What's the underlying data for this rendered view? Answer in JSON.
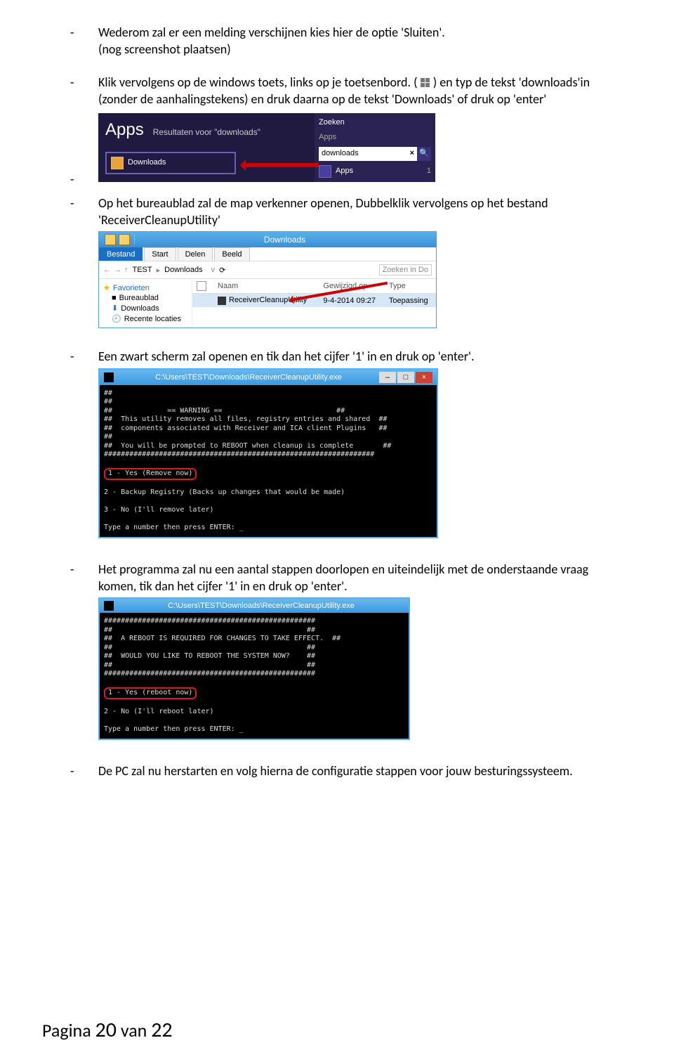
{
  "bullets": {
    "b1": "Wederom zal er een melding verschijnen kies hier de optie 'Sluiten'.",
    "b1_sub": "(nog screenshot plaatsen)",
    "b2": "Klik vervolgens op de windows toets, links op je toetsenbord. (",
    "b2b": ") en typ de tekst 'downloads'in (zonder de aanhalingstekens) en druk daarna op de tekst 'Downloads' of druk op 'enter'",
    "b3": "Op het bureaublad zal de map verkenner openen, Dubbelklik vervolgens op het bestand 'ReceiverCleanupUtility'",
    "b4": "Een zwart scherm zal openen en tik dan het cijfer '1' in en druk op 'enter'.",
    "b5": "Het programma zal nu een aantal stappen doorlopen en uiteindelijk met de onderstaande vraag komen, tik dan het cijfer '1' in en druk op 'enter'.",
    "b6": "De PC zal nu herstarten en volg hierna de configuratie stappen voor jouw besturingssysteem."
  },
  "apps": {
    "title": "Apps",
    "subtitle": "Resultaten voor \"downloads\"",
    "tile": "Downloads",
    "right_title": "Zoeken",
    "right_apps": "Apps",
    "search_value": "downloads",
    "apps_count": "1"
  },
  "explorer": {
    "title": "Downloads",
    "tabs": {
      "active": "Bestand",
      "t2": "Start",
      "t3": "Delen",
      "t4": "Beeld"
    },
    "crumbs": {
      "c1": "TEST",
      "c2": "Downloads"
    },
    "search_ph": "Zoeken in Do",
    "refresh": "⟳",
    "side": {
      "fav": "Favorieten",
      "desk": "Bureaublad",
      "dl": "Downloads",
      "recent": "Recente locaties"
    },
    "cols": {
      "name": "Naam",
      "date": "Gewijzigd op",
      "type": "Type"
    },
    "row": {
      "name": "ReceiverCleanupUtility",
      "date": "9-4-2014 09:27",
      "type": "Toepassing"
    }
  },
  "console1": {
    "path": "C:\\Users\\TEST\\Downloads\\ReceiverCleanupUtility.exe",
    "l1": "##",
    "l2": "##",
    "l3": "##             == WARNING ==                           ##",
    "l4": "##  This utility removes all files, registry entries and shared  ##",
    "l5": "##  components associated with Receiver and ICA client Plugins   ##",
    "l6": "##",
    "l7": "##  You will be prompted to REBOOT when cleanup is complete       ##",
    "l8": "################################################################",
    "opt1": "1 - Yes (Remove now)",
    "opt2": "2 - Backup Registry (Backs up changes that would be made)",
    "opt3": "3 - No (I'll remove later)",
    "prompt": "Type a number then press ENTER: _"
  },
  "console2": {
    "path": "C:\\Users\\TEST\\Downloads\\ReceiverCleanupUtility.exe",
    "l1": "##################################################",
    "l2": "##                                              ##",
    "l3": "##  A REBOOT IS REQUIRED FOR CHANGES TO TAKE EFFECT.  ##",
    "l4": "##                                              ##",
    "l5": "##  WOULD YOU LIKE TO REBOOT THE SYSTEM NOW?    ##",
    "l6": "##                                              ##",
    "l7": "##################################################",
    "opt1": "1 - Yes (reboot now)",
    "opt2": "2 - No (I'll reboot later)",
    "prompt": "Type a number then press ENTER: _"
  },
  "footer": {
    "pre": "Pagina ",
    "cur": "20",
    "mid": " van ",
    "total": "22"
  }
}
